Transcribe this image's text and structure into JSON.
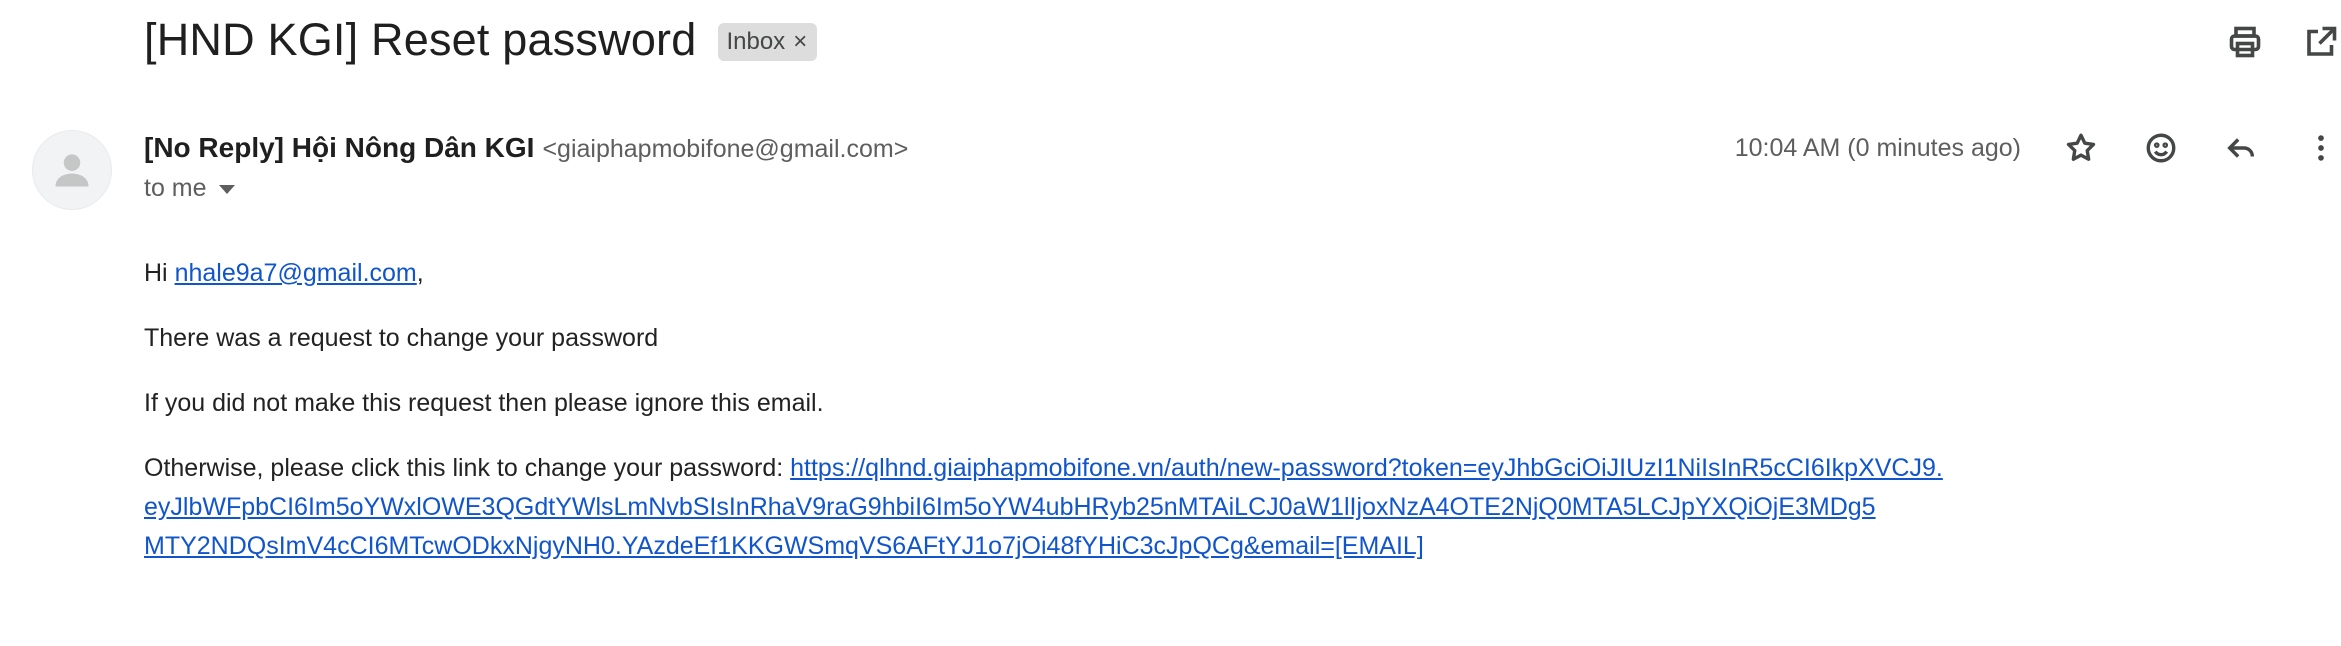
{
  "subject": {
    "title": "[HND KGI] Reset password",
    "label": "Inbox",
    "label_remove": "×"
  },
  "top_actions": {
    "print_icon": "printer-icon",
    "popout_icon": "open-in-new-window-icon"
  },
  "sender": {
    "name": "[No Reply] Hội Nông Dân KGI",
    "email": "<giaiphapmobifone@gmail.com>",
    "to": "to me",
    "time": "10:04 AM (0 minutes ago)"
  },
  "meta_actions": {
    "star_icon": "star-icon",
    "emoji_icon": "emoji-reaction-icon",
    "reply_icon": "reply-icon",
    "more_icon": "more-vert-icon"
  },
  "body": {
    "greeting_prefix": "Hi ",
    "greeting_email": "nhale9a7@gmail.com",
    "greeting_suffix": ",",
    "line1": "There was a request to change your password",
    "line2": "If you did not make this request then please ignore this email.",
    "line3_prefix": "Otherwise, please click this link to change your password: ",
    "reset_link_1": "https://qlhnd.giaiphapmobifone.vn/auth/new-password?token=eyJhbGciOiJIUzI1NiIsInR5cCI6IkpXVCJ9.",
    "reset_link_2": "eyJlbWFpbCI6Im5oYWxlOWE3QGdtYWlsLmNvbSIsInRhaV9raG9hbiI6Im5oYW4ubHRyb25nMTAiLCJ0aW1lIjoxNzA4OTE2NjQ0MTA5LCJpYXQiOjE3MDg5",
    "reset_link_3": "MTY2NDQsImV4cCI6MTcwODkxNjgyNH0.YAzdeEf1KKGWSmqVS6AFtYJ1o7jOi48fYHiC3cJpQCg&email=[EMAIL]"
  },
  "colors": {
    "link": "#1155cc",
    "chip_bg": "#dddddd",
    "text": "#1f1f1f",
    "muted": "#5e5e5e"
  }
}
